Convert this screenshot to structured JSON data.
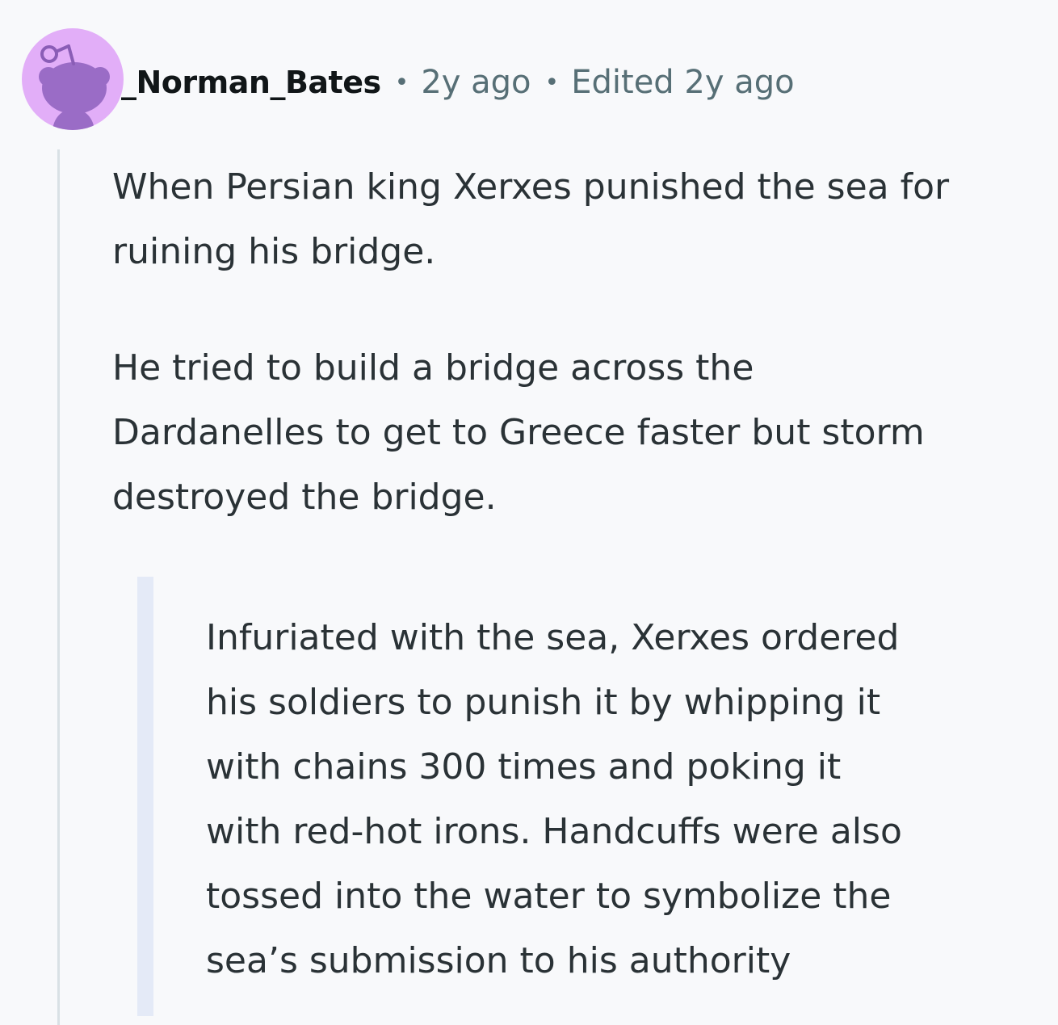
{
  "comment": {
    "author": "_Norman_Bates",
    "separator": "•",
    "posted_time": "2y ago",
    "edited_label": "Edited 2y ago",
    "avatar_icon": "reddit-snoo-avatar-icon",
    "avatar_color": "#e2aef8",
    "body": {
      "paragraphs": [
        {
          "lines": [
            "When Persian king Xerxes punished the sea for",
            "ruining his bridge."
          ]
        },
        {
          "lines": [
            "He tried to build a bridge across the",
            "Dardanelles to get to Greece faster but storm",
            "destroyed the bridge."
          ]
        }
      ],
      "blockquote": {
        "lines": [
          "Infuriated with the sea, Xerxes ordered",
          "his soldiers to punish it by whipping it",
          "with chains 300 times and poking it",
          "with red-hot irons. Handcuffs were also",
          "tossed into the water to symbolize the",
          "sea’s submission to his authority"
        ]
      }
    }
  }
}
